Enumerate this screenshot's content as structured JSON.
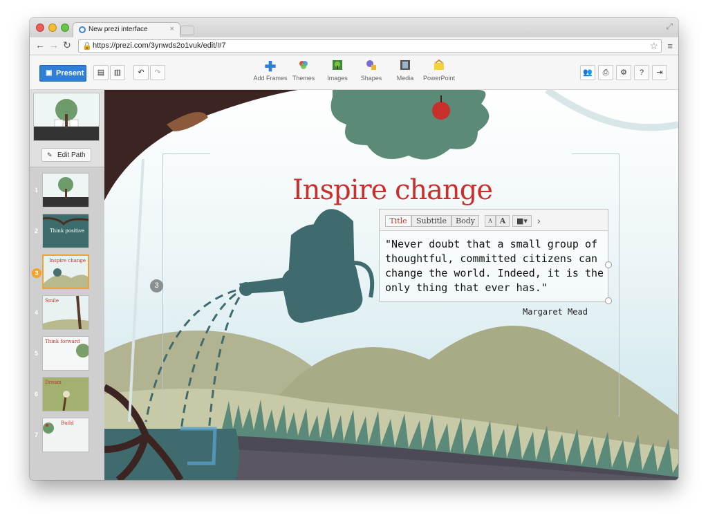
{
  "browser": {
    "tab_title": "New prezi interface",
    "tab_close": "×",
    "url_host": "prezi.com",
    "url_full": "https://prezi.com/3ynwds2o1vuk/edit/#7"
  },
  "toolbar": {
    "present_label": "Present",
    "tools": [
      {
        "label": "Add Frames",
        "icon": "add-frames-icon"
      },
      {
        "label": "Themes",
        "icon": "themes-icon"
      },
      {
        "label": "Images",
        "icon": "images-icon"
      },
      {
        "label": "Shapes",
        "icon": "shapes-icon"
      },
      {
        "label": "Media",
        "icon": "media-icon"
      },
      {
        "label": "PowerPoint",
        "icon": "powerpoint-icon"
      }
    ]
  },
  "sidebar": {
    "edit_path_label": "Edit Path",
    "slides": [
      {
        "num": "1",
        "title": ""
      },
      {
        "num": "2",
        "title": "Think positive"
      },
      {
        "num": "3",
        "title": "Inspire change"
      },
      {
        "num": "4",
        "title": "Smile"
      },
      {
        "num": "5",
        "title": "Think forward"
      },
      {
        "num": "6",
        "title": "Dream"
      },
      {
        "num": "7",
        "title": "Build"
      }
    ],
    "active_slide": 3
  },
  "canvas": {
    "headline": "Inspire change",
    "quote": "\"Never doubt that a small group of thoughtful, committed citizens can change the world. Indeed, it is the only thing that ever has.\"",
    "author": "Margaret Mead",
    "step_badge": "3"
  },
  "format_bar": {
    "title": "Title",
    "subtitle": "Subtitle",
    "body": "Body",
    "small_a": "A",
    "big_a": "A",
    "more": "›"
  },
  "colors": {
    "accent": "#2f7fd6",
    "headline": "#c9302c",
    "active_slide": "#f2a42a"
  }
}
